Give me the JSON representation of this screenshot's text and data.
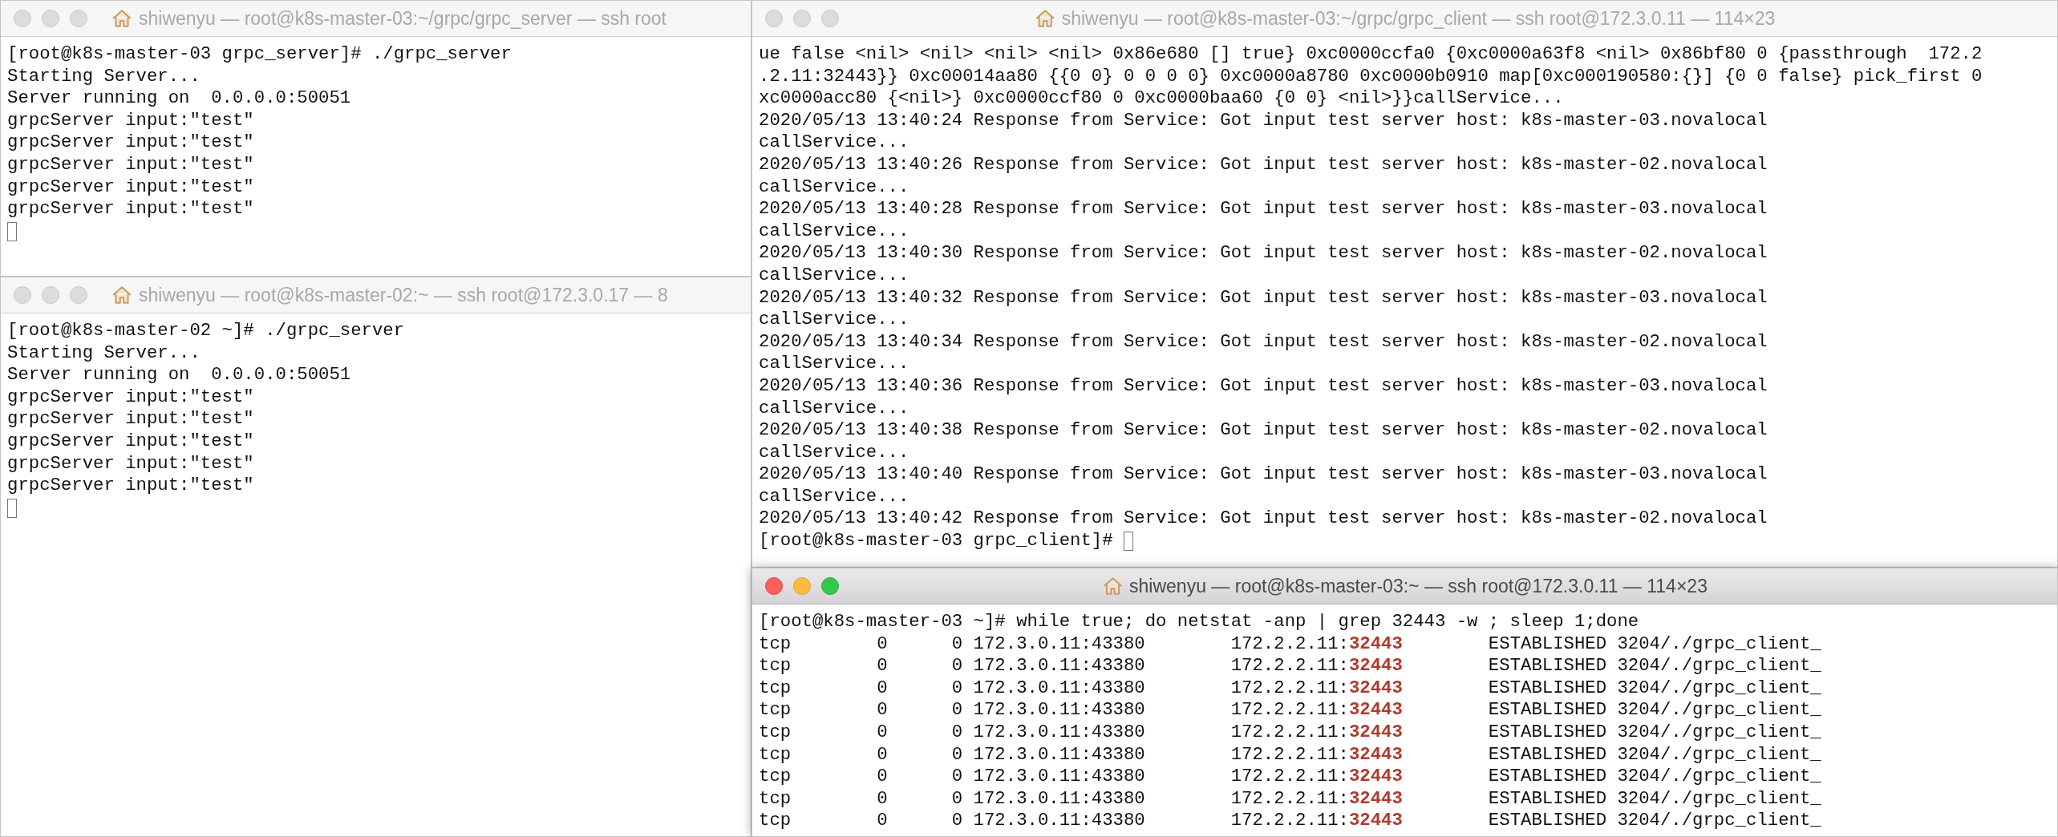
{
  "windows": [
    {
      "title": "shiwenyu — root@k8s-master-03:~/grpc/grpc_server — ssh root",
      "active": false,
      "lines": [
        "[root@k8s-master-03 grpc_server]# ./grpc_server",
        "Starting Server...",
        "Server running on  0.0.0.0:50051",
        "grpcServer input:\"test\"",
        "grpcServer input:\"test\"",
        "grpcServer input:\"test\"",
        "grpcServer input:\"test\"",
        "grpcServer input:\"test\""
      ],
      "cursor": true
    },
    {
      "title": "shiwenyu — root@k8s-master-02:~ — ssh root@172.3.0.17 — 8",
      "active": false,
      "lines": [
        "[root@k8s-master-02 ~]# ./grpc_server",
        "Starting Server...",
        "Server running on  0.0.0.0:50051",
        "grpcServer input:\"test\"",
        "grpcServer input:\"test\"",
        "grpcServer input:\"test\"",
        "grpcServer input:\"test\"",
        "grpcServer input:\"test\""
      ],
      "cursor": true
    },
    {
      "title": "shiwenyu — root@k8s-master-03:~/grpc/grpc_client — ssh root@172.3.0.11 — 114×23",
      "active": false,
      "lines": [
        "ue false <nil> <nil> <nil> <nil> 0x86e680 [] true} 0xc0000ccfa0 {0xc0000a63f8 <nil> 0x86bf80 0 {passthrough  172.2",
        ".2.11:32443}} 0xc00014aa80 {{0 0} 0 0 0 0} 0xc0000a8780 0xc0000b0910 map[0xc000190580:{}] {0 0 false} pick_first 0",
        "xc0000acc80 {<nil>} 0xc0000ccf80 0 0xc0000baa60 {0 0} <nil>}}callService...",
        "2020/05/13 13:40:24 Response from Service: Got input test server host: k8s-master-03.novalocal",
        "callService...",
        "2020/05/13 13:40:26 Response from Service: Got input test server host: k8s-master-02.novalocal",
        "callService...",
        "2020/05/13 13:40:28 Response from Service: Got input test server host: k8s-master-03.novalocal",
        "callService...",
        "2020/05/13 13:40:30 Response from Service: Got input test server host: k8s-master-02.novalocal",
        "callService...",
        "2020/05/13 13:40:32 Response from Service: Got input test server host: k8s-master-03.novalocal",
        "callService...",
        "2020/05/13 13:40:34 Response from Service: Got input test server host: k8s-master-02.novalocal",
        "callService...",
        "2020/05/13 13:40:36 Response from Service: Got input test server host: k8s-master-03.novalocal",
        "callService...",
        "2020/05/13 13:40:38 Response from Service: Got input test server host: k8s-master-02.novalocal",
        "callService...",
        "2020/05/13 13:40:40 Response from Service: Got input test server host: k8s-master-03.novalocal",
        "callService...",
        "2020/05/13 13:40:42 Response from Service: Got input test server host: k8s-master-02.novalocal"
      ],
      "prompt": "[root@k8s-master-03 grpc_client]# "
    },
    {
      "title": "shiwenyu — root@k8s-master-03:~ — ssh root@172.3.0.11 — 114×23",
      "active": true,
      "lines": [
        "[root@k8s-master-03 ~]# while true; do netstat -anp | grep 32443 -w ; sleep 1;done"
      ],
      "rows": [
        {
          "text_before": "tcp        0      0 172.3.0.11:43380        172.2.2.11:",
          "port": "32443",
          "text_after": "        ESTABLISHED 3204/./grpc_client_"
        },
        {
          "text_before": "tcp        0      0 172.3.0.11:43380        172.2.2.11:",
          "port": "32443",
          "text_after": "        ESTABLISHED 3204/./grpc_client_"
        },
        {
          "text_before": "tcp        0      0 172.3.0.11:43380        172.2.2.11:",
          "port": "32443",
          "text_after": "        ESTABLISHED 3204/./grpc_client_"
        },
        {
          "text_before": "tcp        0      0 172.3.0.11:43380        172.2.2.11:",
          "port": "32443",
          "text_after": "        ESTABLISHED 3204/./grpc_client_"
        },
        {
          "text_before": "tcp        0      0 172.3.0.11:43380        172.2.2.11:",
          "port": "32443",
          "text_after": "        ESTABLISHED 3204/./grpc_client_"
        },
        {
          "text_before": "tcp        0      0 172.3.0.11:43380        172.2.2.11:",
          "port": "32443",
          "text_after": "        ESTABLISHED 3204/./grpc_client_"
        },
        {
          "text_before": "tcp        0      0 172.3.0.11:43380        172.2.2.11:",
          "port": "32443",
          "text_after": "        ESTABLISHED 3204/./grpc_client_"
        },
        {
          "text_before": "tcp        0      0 172.3.0.11:43380        172.2.2.11:",
          "port": "32443",
          "text_after": "        ESTABLISHED 3204/./grpc_client_"
        },
        {
          "text_before": "tcp        0      0 172.3.0.11:43380        172.2.2.11:",
          "port": "32443",
          "text_after": "        ESTABLISHED 3204/./grpc_client_"
        }
      ]
    }
  ]
}
